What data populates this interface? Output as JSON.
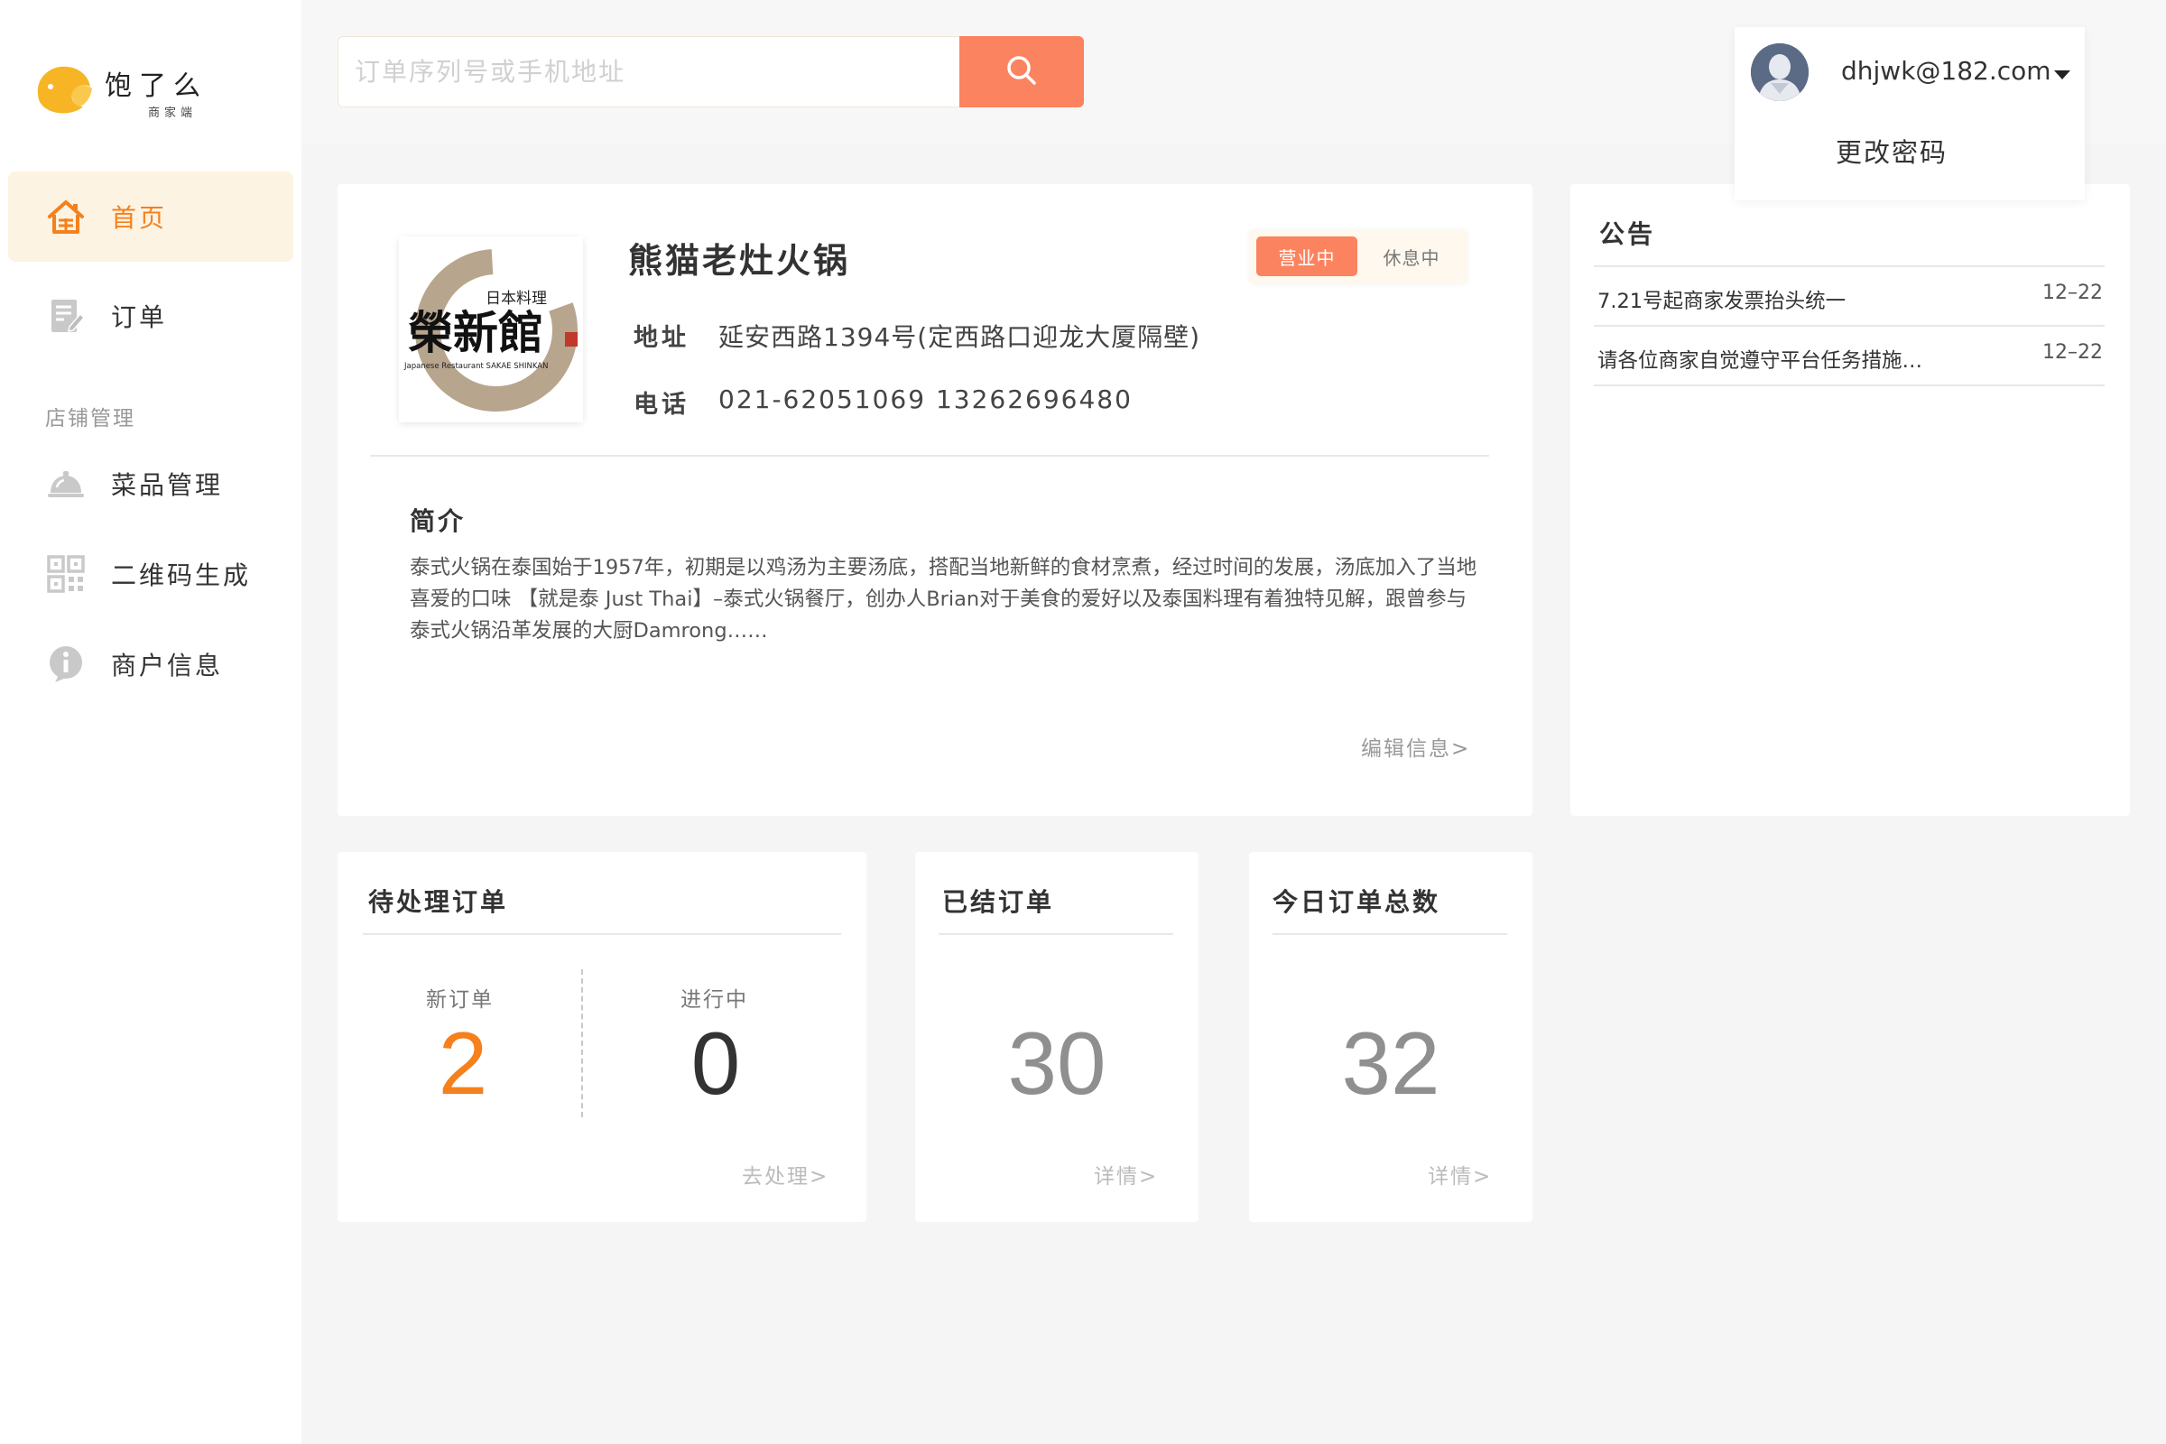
{
  "brand": {
    "name": "饱了么",
    "subtitle": "商家端",
    "accent_color": "#f5a623"
  },
  "sidebar": {
    "items": [
      {
        "label": "首页",
        "icon": "home-icon",
        "active": true
      },
      {
        "label": "订单",
        "icon": "order-icon",
        "active": false
      }
    ],
    "section_label": "店铺管理",
    "section_items": [
      {
        "label": "菜品管理",
        "icon": "dish-cover-icon"
      },
      {
        "label": "二维码生成",
        "icon": "qrcode-icon"
      },
      {
        "label": "商户信息",
        "icon": "info-icon"
      }
    ],
    "active_color": "#f5801c",
    "active_bg": "#fdf3e3"
  },
  "search": {
    "placeholder": "订单序列号或手机地址",
    "value": "",
    "button_icon": "search-icon",
    "button_color": "#fc8360"
  },
  "user": {
    "email": "dhjwk@182.com",
    "avatar_icon": "user-avatar-icon",
    "menu_items": [
      "更改密码"
    ]
  },
  "store": {
    "name": "熊猫老灶火锅",
    "logo_icon": "store-logo-image",
    "logo_text": "日本料理",
    "logo_chars": "榮新館",
    "logo_caption": "Japanese Restaurant SAKAE SHINKAN",
    "status_options": [
      "营业中",
      "休息中"
    ],
    "status_selected": "营业中",
    "address_label": "地址",
    "address": "延安西路1394号(定西路口迎龙大厦隔壁)",
    "phone_label": "电话",
    "phone": "021-62051069 13262696480",
    "intro_title": "简介",
    "intro": "泰式火锅在泰国始于1957年，初期是以鸡汤为主要汤底，搭配当地新鲜的食材烹煮，经过时间的发展，汤底加入了当地喜爱的口味 【就是泰 Just Thai】–泰式火锅餐厅，创办人Brian对于美食的爱好以及泰国料理有着独特见解，跟曾参与泰式火锅沿革发展的大厨Damrong……",
    "edit_link": "编辑信息>"
  },
  "notices": {
    "title": "公告",
    "items": [
      {
        "text": "7.21号起商家发票抬头统一",
        "date": "12–22"
      },
      {
        "text": "请各位商家自觉遵守平台任务措施…",
        "date": "12–22"
      }
    ]
  },
  "stats": {
    "pending": {
      "title": "待处理订单",
      "new_label": "新订单",
      "new_value": "2",
      "progress_label": "进行中",
      "progress_value": "0",
      "link": "去处理>"
    },
    "settled": {
      "title": "已结订单",
      "value": "30",
      "link": "详情>"
    },
    "today": {
      "title": "今日订单总数",
      "value": "32",
      "link": "详情>"
    }
  }
}
